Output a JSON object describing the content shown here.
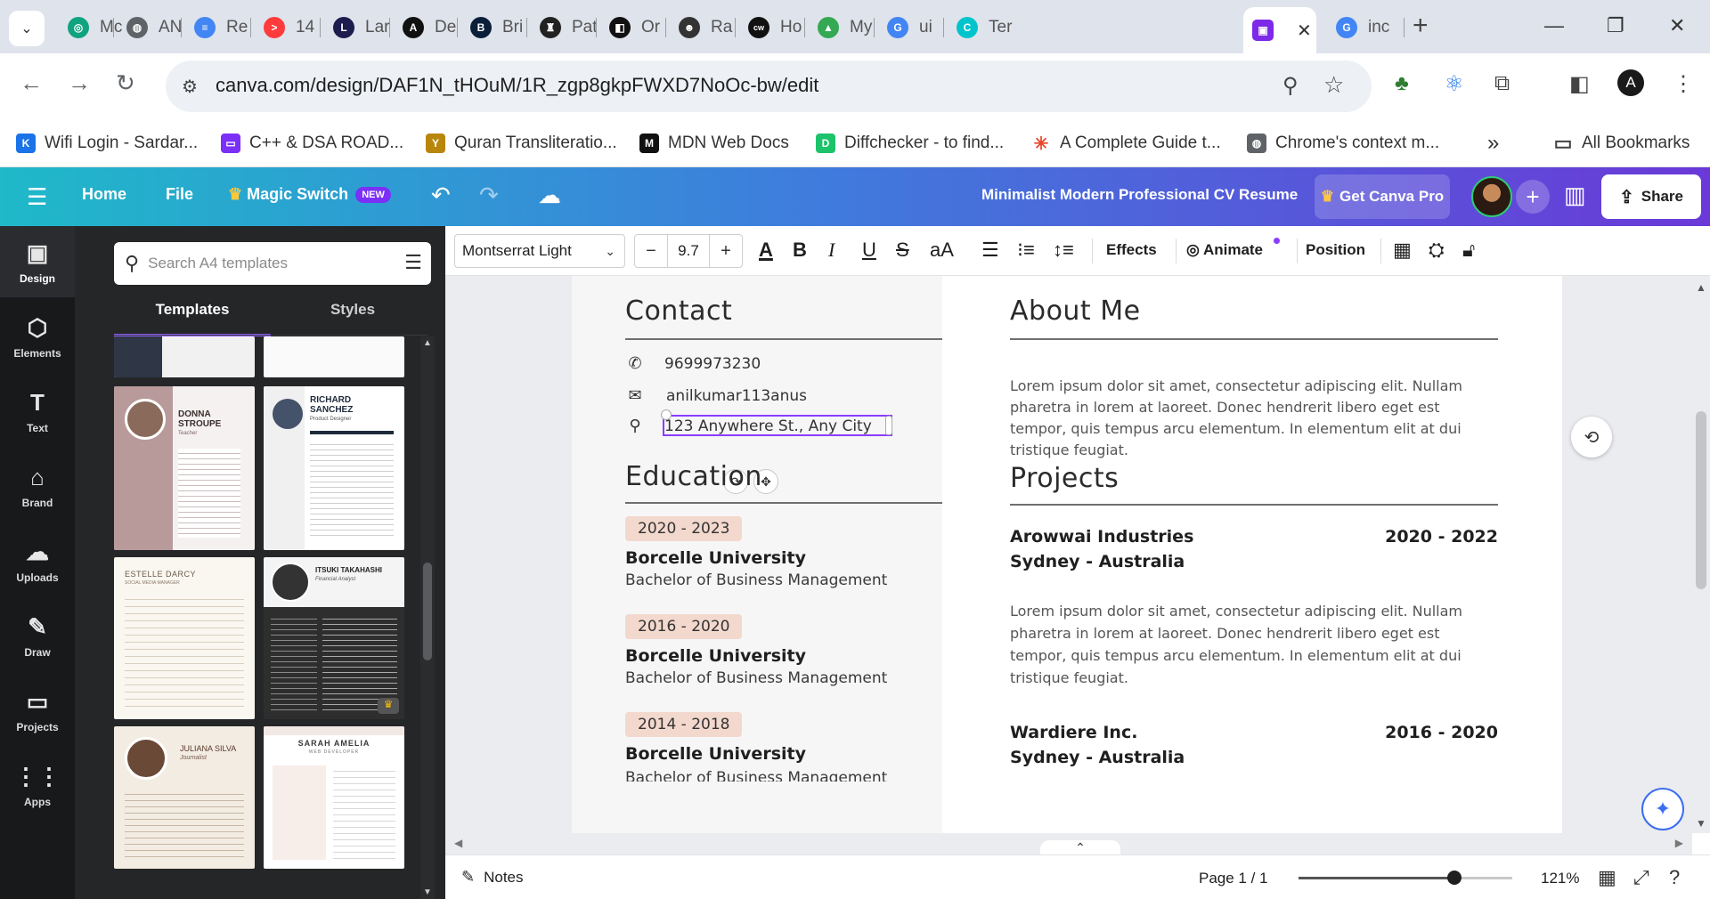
{
  "browser": {
    "tabs": [
      {
        "label": "Mc",
        "color": "#10a37f",
        "glyph": "◎"
      },
      {
        "label": "AN",
        "color": "#5f6368",
        "glyph": "◍"
      },
      {
        "label": "Re",
        "color": "#4285f4",
        "glyph": "≡"
      },
      {
        "label": "14",
        "color": "#ff3b3b",
        "glyph": ">"
      },
      {
        "label": "Lar",
        "color": "#1c1c4f",
        "glyph": "L"
      },
      {
        "label": "De",
        "color": "#111111",
        "glyph": "A"
      },
      {
        "label": "Bri",
        "color": "#0b1f3a",
        "glyph": "B"
      },
      {
        "label": "Pat",
        "color": "#222222",
        "glyph": "♜"
      },
      {
        "label": "Or",
        "color": "#111111",
        "glyph": "◧"
      },
      {
        "label": "Ra",
        "color": "#333333",
        "glyph": "☻"
      },
      {
        "label": "Ho",
        "color": "#111111",
        "glyph": "cw"
      },
      {
        "label": "My",
        "color": "#34a853",
        "glyph": "▲"
      },
      {
        "label": "ui",
        "color": "#4285f4",
        "glyph": "G"
      },
      {
        "label": "Ter",
        "color": "#00c4cc",
        "glyph": "C"
      }
    ],
    "active_tab_glyph": "▣",
    "last_tab": {
      "label": "inc",
      "glyph": "G"
    },
    "url": "canva.com/design/DAF1N_tHOuM/1R_zgp8gkpFWXD7NoOc-bw/edit",
    "profile_initial": "A",
    "bookmarks": [
      {
        "label": "Wifi Login - Sardar...",
        "color": "#1a73e8",
        "glyph": "K"
      },
      {
        "label": "C++ & DSA ROAD...",
        "color": "#7b2ff7",
        "glyph": "▭"
      },
      {
        "label": "Quran Transliteratio...",
        "color": "#b8860b",
        "glyph": "Y"
      },
      {
        "label": "MDN Web Docs",
        "color": "#111111",
        "glyph": "M"
      },
      {
        "label": "Diffchecker - to find...",
        "color": "#1cc36b",
        "glyph": "D"
      },
      {
        "label": "A Complete Guide t...",
        "color": "#e8462a",
        "glyph": "✳"
      },
      {
        "label": "Chrome's context m...",
        "color": "#5f6368",
        "glyph": "◍"
      }
    ],
    "all_bookmarks": "All Bookmarks",
    "overflow": "»"
  },
  "canva_header": {
    "home": "Home",
    "file": "File",
    "magic_switch": "Magic Switch",
    "new_badge": "NEW",
    "doc_title": "Minimalist Modern Professional CV Resume",
    "get_pro": "Get Canva Pro",
    "share": "Share"
  },
  "rail": [
    {
      "label": "Design",
      "icon": "▣"
    },
    {
      "label": "Elements",
      "icon": "⬡"
    },
    {
      "label": "Text",
      "icon": "T"
    },
    {
      "label": "Brand",
      "icon": "⌂"
    },
    {
      "label": "Uploads",
      "icon": "☁"
    },
    {
      "label": "Draw",
      "icon": "✎"
    },
    {
      "label": "Projects",
      "icon": "▭"
    },
    {
      "label": "Apps",
      "icon": "⋮⋮"
    }
  ],
  "panel": {
    "search_placeholder": "Search A4 templates",
    "tabs": [
      "Templates",
      "Styles"
    ],
    "templates": [
      {
        "name": "DONNA STROUPE",
        "sub": "Teacher",
        "bg": "#b89a9a"
      },
      {
        "name": "RICHARD SANCHEZ",
        "sub": "Product Designer",
        "bg": "#ffffff"
      },
      {
        "name": "ESTELLE DARCY",
        "sub": "SOCIAL MEDIA MANAGER",
        "bg": "#faf7f0"
      },
      {
        "name": "ITSUKI TAKAHASHI",
        "sub": "Financial Analyst",
        "bg": "#2e2e2e"
      },
      {
        "name": "JULIANA SILVA",
        "sub": "Journalist",
        "bg": "#f3ece3"
      },
      {
        "name": "SARAH AMELIA",
        "sub": "WEB DEVELOPER",
        "bg": "#ffffff"
      }
    ]
  },
  "text_toolbar": {
    "font": "Montserrat Light",
    "size": "9.7",
    "effects": "Effects",
    "animate": "Animate",
    "position": "Position"
  },
  "resume": {
    "contact_title": "Contact",
    "phone": "9699973230",
    "email_editing": "anilkumar113anus",
    "address": "123 Anywhere St., Any City",
    "education_title": "Education",
    "education": [
      {
        "years": "2020 - 2023",
        "school": "Borcelle University",
        "degree": "Bachelor of Business Management"
      },
      {
        "years": "2016 - 2020",
        "school": "Borcelle University",
        "degree": "Bachelor of Business Management"
      },
      {
        "years": "2014 - 2018",
        "school": "Borcelle University",
        "degree": "Bachelor of Business Management"
      }
    ],
    "about_title": "About Me",
    "about_text": "Lorem ipsum dolor sit amet, consectetur adipiscing elit. Nullam pharetra in lorem at laoreet. Donec hendrerit libero eget est tempor, quis tempus arcu elementum. In elementum elit at dui tristique feugiat.",
    "projects_title": "Projects",
    "projects": [
      {
        "company": "Arowwai Industries",
        "years": "2020 - 2022",
        "location": "Sydney - Australia",
        "text": "Lorem ipsum dolor sit amet, consectetur adipiscing elit. Nullam pharetra in lorem at laoreet. Donec hendrerit libero eget est tempor, quis tempus arcu elementum. In elementum elit at dui tristique feugiat."
      },
      {
        "company": "Wardiere Inc.",
        "years": "2016 - 2020",
        "location": "Sydney - Australia"
      }
    ]
  },
  "footer": {
    "notes": "Notes",
    "page": "Page 1 / 1",
    "zoom": "121%",
    "zoom_level": 0.73
  }
}
